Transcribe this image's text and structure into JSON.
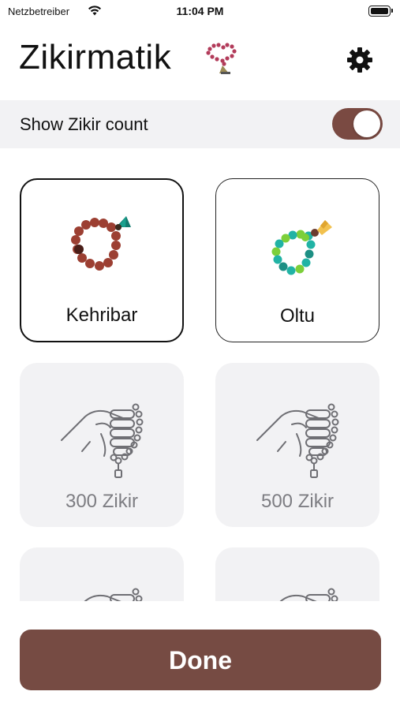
{
  "status_bar": {
    "carrier": "Netzbetreiber",
    "time": "11:04 PM"
  },
  "header": {
    "title": "Zikirmatik",
    "logo_icon": "tesbih-icon",
    "settings_icon": "gear-icon"
  },
  "toggle": {
    "label": "Show Zikir count",
    "on": true,
    "color": "#7a4a42"
  },
  "items": [
    {
      "label": "Kehribar",
      "selected": true,
      "icon": "red-beads-icon"
    },
    {
      "label": "Oltu",
      "selected": false,
      "icon": "green-beads-icon"
    },
    {
      "label": "300 Zikir",
      "locked": true,
      "icon": "hand-tesbih-icon"
    },
    {
      "label": "500 Zikir",
      "locked": true,
      "icon": "hand-tesbih-icon"
    },
    {
      "label": "",
      "locked": true,
      "icon": "hand-tesbih-icon"
    },
    {
      "label": "",
      "locked": true,
      "icon": "hand-tesbih-icon"
    }
  ],
  "done_button": {
    "label": "Done",
    "color": "#764b43"
  }
}
